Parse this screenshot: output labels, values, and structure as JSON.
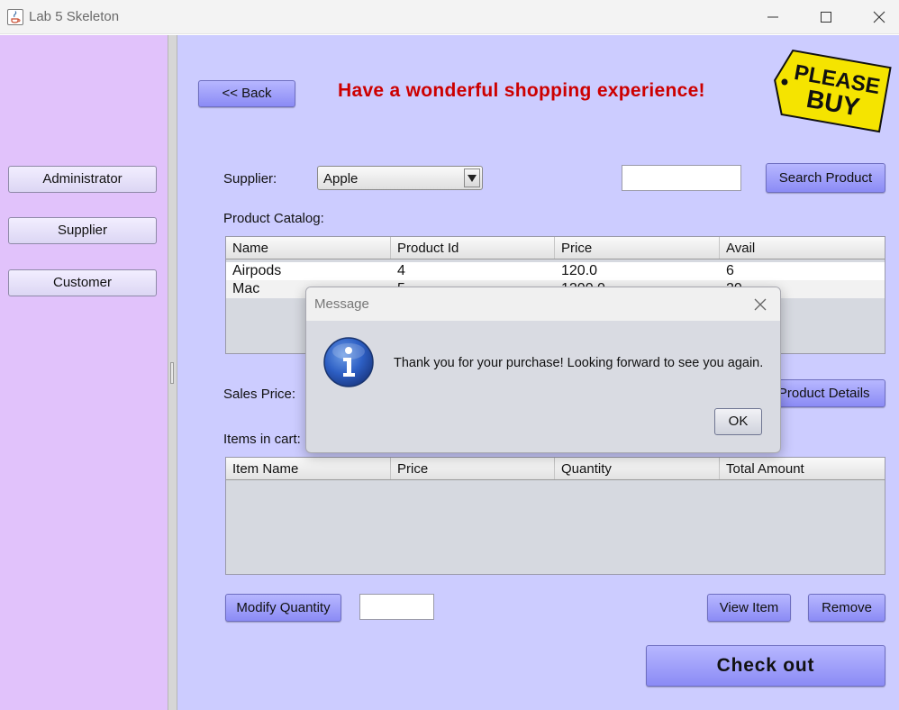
{
  "window": {
    "title": "Lab 5 Skeleton"
  },
  "sidebar": {
    "buttons": [
      {
        "label": "Administrator"
      },
      {
        "label": "Supplier"
      },
      {
        "label": "Customer"
      }
    ]
  },
  "header": {
    "back_label": "<< Back",
    "headline": "Have a wonderful shopping experience!",
    "logo_text_1": "PLEASE",
    "logo_text_2": "BUY"
  },
  "search": {
    "supplier_label": "Supplier:",
    "supplier_value": "Apple",
    "search_value": "",
    "search_button": "Search Product"
  },
  "catalog": {
    "label": "Product Catalog:",
    "columns": [
      "Name",
      "Product Id",
      "Price",
      "Avail"
    ],
    "rows": [
      [
        "Airpods",
        "4",
        "120.0",
        "6"
      ],
      [
        "Mac",
        "5",
        "1200.0",
        "20"
      ]
    ]
  },
  "sales": {
    "price_label": "Sales Price:",
    "details_button": "View Product Details"
  },
  "cart": {
    "label": "Items in cart:",
    "columns": [
      "Item Name",
      "Price",
      "Quantity",
      "Total Amount"
    ],
    "modify_button": "Modify Quantity",
    "quantity_value": "",
    "view_button": "View Item",
    "remove_button": "Remove",
    "checkout_button": "Check out"
  },
  "dialog": {
    "title": "Message",
    "message": "Thank you for your purchase! Looking forward to see you again.",
    "ok_label": "OK"
  },
  "colors": {
    "sidebar_bg": "#e1c2fb",
    "main_bg": "#ccccff",
    "button": "#9999ff",
    "headline": "#cc0000",
    "logo": "#f5e400"
  }
}
